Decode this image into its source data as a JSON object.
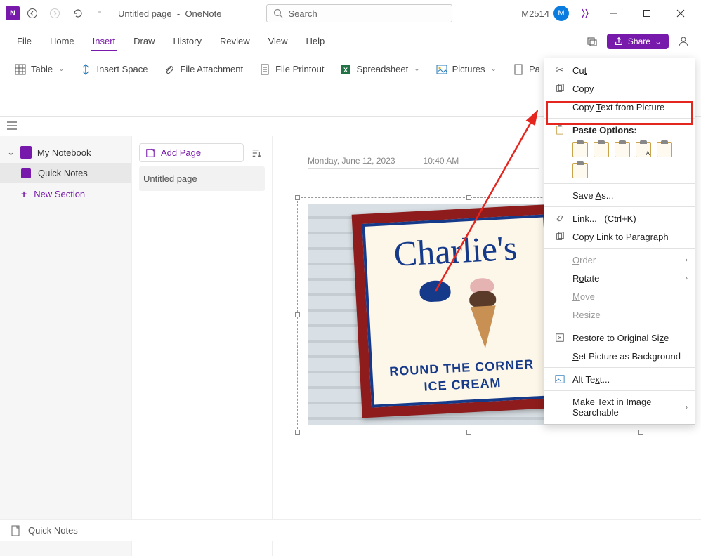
{
  "titlebar": {
    "page_title": "Untitled page",
    "separator": "-",
    "app_name": "OneNote",
    "search_placeholder": "Search",
    "user_label": "M2514",
    "avatar_initial": "M"
  },
  "tabs": {
    "items": [
      "File",
      "Home",
      "Insert",
      "Draw",
      "History",
      "Review",
      "View",
      "Help"
    ],
    "active_index": 2,
    "share_label": "Share"
  },
  "ribbon": {
    "table": "Table",
    "insert_space": "Insert Space",
    "file_attachment": "File Attachment",
    "file_printout": "File Printout",
    "spreadsheet": "Spreadsheet",
    "pictures": "Pictures",
    "pa_truncated": "Pa"
  },
  "sidebar": {
    "notebook_name": "My Notebook",
    "section_active": "Quick Notes",
    "new_section": "New Section"
  },
  "pages": {
    "add_page": "Add Page",
    "entries": [
      "Untitled page"
    ]
  },
  "canvas": {
    "date": "Monday, June 12, 2023",
    "time": "10:40 AM",
    "sign_main": "Charlie's",
    "sign_line1": "ROUND THE CORNER",
    "sign_line2": "ICE CREAM"
  },
  "context_menu": {
    "cut": "Cut",
    "copy": "Copy",
    "copy_text_from_picture": "Copy Text from Picture",
    "paste_options": "Paste Options:",
    "save_as": "Save As...",
    "link": "Link...   (Ctrl+K)",
    "copy_link_paragraph": "Copy Link to Paragraph",
    "order": "Order",
    "rotate": "Rotate",
    "move": "Move",
    "resize": "Resize",
    "restore": "Restore to Original Size",
    "set_background": "Set Picture as Background",
    "alt_text": "Alt Text...",
    "make_searchable": "Make Text in Image Searchable"
  },
  "status": {
    "label": "Quick Notes"
  }
}
